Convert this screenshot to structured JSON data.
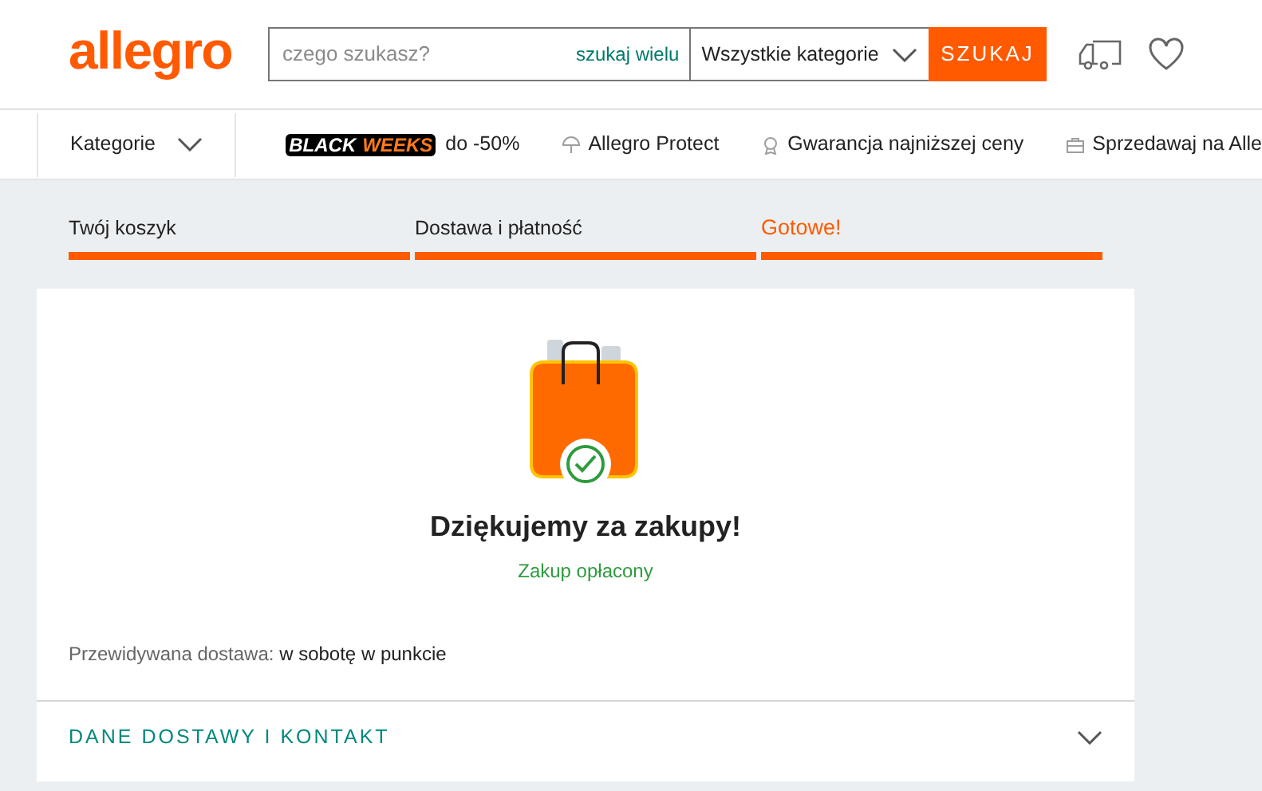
{
  "header": {
    "logo": "allegro",
    "search": {
      "placeholder": "czego szukasz?",
      "link": "szukaj wielu",
      "category": "Wszystkie kategorie",
      "button": "SZUKAJ"
    }
  },
  "nav": {
    "categories": "Kategorie",
    "promo": {
      "badge_left": "BLACK",
      "badge_right": "WEEKS",
      "text": "do -50%"
    },
    "links": [
      {
        "kind": "umbrella",
        "label": "Allegro Protect"
      },
      {
        "kind": "medal",
        "label": "Gwarancja najniższej ceny"
      },
      {
        "kind": "briefcase",
        "label": "Sprzedawaj na Alle"
      }
    ]
  },
  "steps": [
    {
      "label": "Twój koszyk",
      "selected": false
    },
    {
      "label": "Dostawa i płatność",
      "selected": false
    },
    {
      "label": "Gotowe!",
      "selected": true
    }
  ],
  "confirmation": {
    "title": "Dziękujemy za zakupy!",
    "status": "Zakup opłacony",
    "delivery_label": "Przewidywana dostawa:",
    "delivery_value": "w sobotę w punkcie"
  },
  "accordion": {
    "title": "DANE DOSTAWY I KONTAKT",
    "expanded": false
  }
}
